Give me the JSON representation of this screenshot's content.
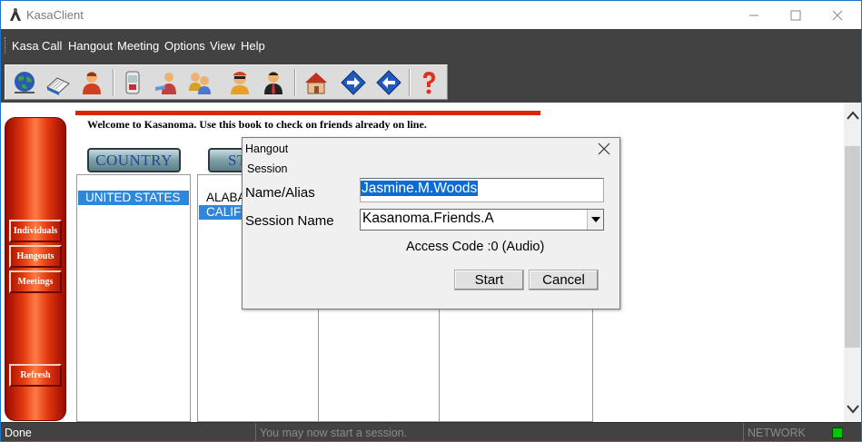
{
  "window": {
    "title": "KasaClient"
  },
  "menu": [
    "Kasa",
    "Call",
    "Hangout",
    "Meeting",
    "Options",
    "View",
    "Help"
  ],
  "toolbar": {
    "buttons": [
      "globe-icon",
      "book-icon",
      "person-icon",
      "phone-icon",
      "handshake-icon",
      "group-icon",
      "user-sunglasses-icon",
      "user-tie-icon",
      "home-icon",
      "arrow-right-icon",
      "arrow-left-icon",
      "help-icon"
    ]
  },
  "sidebar": {
    "individuals": "Individuals",
    "hangouts": "Hangouts",
    "meetings": "Meetings",
    "refresh": "Refresh"
  },
  "main": {
    "welcome": "Welcome to Kasanoma. Use this book to check on friends already on line.",
    "country_header": "COUNTRY",
    "state_header_partial": "ST",
    "countries": [
      "UNITED STATES"
    ],
    "states": [
      "ALABA",
      "CALIF"
    ]
  },
  "dialog": {
    "title": "Hangout",
    "menu_session": "Session",
    "name_label": "Name/Alias",
    "name_value": "Jasmine.M.Woods",
    "session_label": "Session Name",
    "session_value": "Kasanoma.Friends.A",
    "access_code": "Access Code :0 (Audio)",
    "start_label": "Start",
    "cancel_label": "Cancel"
  },
  "status": {
    "left": "Done",
    "message": "You may now start a session.",
    "network": "NETWORK",
    "led_color": "#00c800"
  },
  "colors": {
    "accent_red": "#d82a00",
    "selection": "#2f86dd",
    "chrome_dark": "#424242"
  }
}
